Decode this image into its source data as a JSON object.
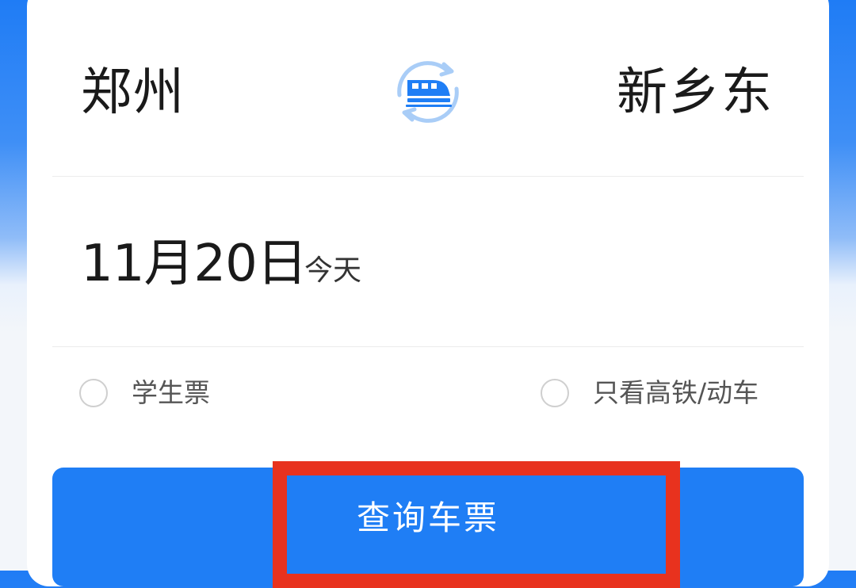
{
  "route": {
    "from_station": "郑州",
    "to_station": "新乡东",
    "swap_icon": "train-swap-icon"
  },
  "date": {
    "value": "11月20日",
    "relative": "今天"
  },
  "options": {
    "student_ticket": {
      "label": "学生票",
      "checked": false
    },
    "high_speed_only": {
      "label": "只看高铁/动车",
      "checked": false
    }
  },
  "actions": {
    "query_label": "查询车票"
  },
  "colors": {
    "primary": "#1f7ef5",
    "highlight": "#e8321e",
    "swap_icon_ring": "#a9cdf7",
    "swap_icon_train": "#1f7ef5"
  }
}
